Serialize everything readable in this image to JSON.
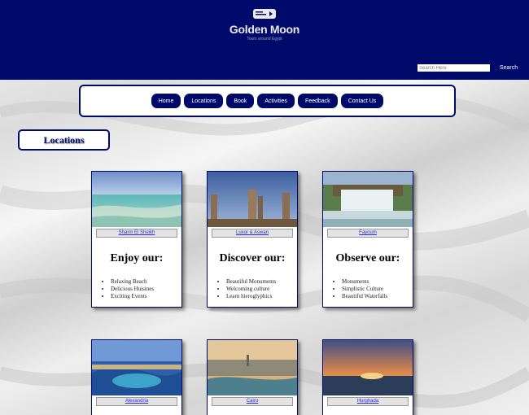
{
  "header": {
    "brand": "Golden Moon",
    "tagline": "Tours around Egypt",
    "search_placeholder": "Search Here",
    "search_button": "Search"
  },
  "nav": {
    "items": [
      {
        "label": "Home"
      },
      {
        "label": "Locations"
      },
      {
        "label": "Book"
      },
      {
        "label": "Activities"
      },
      {
        "label": "Feedback"
      },
      {
        "label": "Contact Us"
      }
    ]
  },
  "page": {
    "title": "Locations"
  },
  "cards": [
    {
      "link": "Sharm El Sheikh",
      "heading": "Enjoy our:",
      "items": [
        "Relaxing Beach",
        "Delicious Huisines",
        "Exciting Events"
      ],
      "image": "beach-photo"
    },
    {
      "link": "Luxor & Aswan",
      "heading": "Discover our:",
      "items": [
        "Beautiful Monuments",
        "Welcoming culture",
        "Learn hieroglyphics"
      ],
      "image": "temple-photo"
    },
    {
      "link": "Fayoum",
      "heading": "Observe our:",
      "items": [
        "Monuments",
        "Simplistic Culture",
        "Beautiful Waterfalls"
      ],
      "image": "waterfall-photo"
    },
    {
      "link": "Alexandria",
      "image": "alexandria-photo"
    },
    {
      "link": "Cairo",
      "image": "cairo-photo"
    },
    {
      "link": "Hurghada",
      "image": "hurghada-photo"
    }
  ],
  "colors": {
    "primary": "#000a6b",
    "link": "#2a2ae0"
  }
}
